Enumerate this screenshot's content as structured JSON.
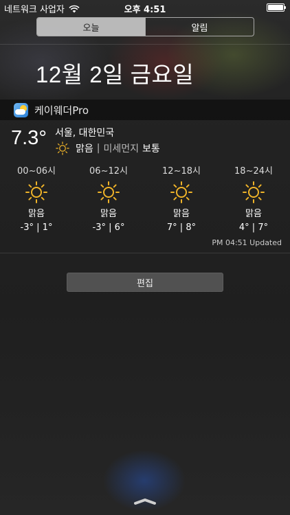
{
  "status_bar": {
    "carrier": "네트워크 사업자",
    "time": "오후 4:51"
  },
  "tabs": [
    {
      "label": "오늘",
      "active": true
    },
    {
      "label": "알림",
      "active": false
    }
  ],
  "date_title": "12월 2일 금요일",
  "widget": {
    "app_name": "케이웨더Pro",
    "current_temp": "7.3°",
    "location": "서울, 대한민국",
    "condition": "맑음",
    "divider": "|",
    "dust_label": "미세먼지",
    "dust_value": "보통",
    "icon": "sun-icon",
    "forecast": [
      {
        "time": "00~06시",
        "condition": "맑음",
        "low": "-3°",
        "high": "1°",
        "icon": "sun-icon"
      },
      {
        "time": "06~12시",
        "condition": "맑음",
        "low": "-3°",
        "high": "6°",
        "icon": "sun-icon"
      },
      {
        "time": "12~18시",
        "condition": "맑음",
        "low": "7°",
        "high": "8°",
        "icon": "sun-icon"
      },
      {
        "time": "18~24시",
        "condition": "맑음",
        "low": "4°",
        "high": "7°",
        "icon": "sun-icon"
      }
    ],
    "updated": "PM 04:51 Updated"
  },
  "edit_label": "편집",
  "colors": {
    "sun": "#f0b429",
    "active_tab": "#d2d2d2"
  }
}
